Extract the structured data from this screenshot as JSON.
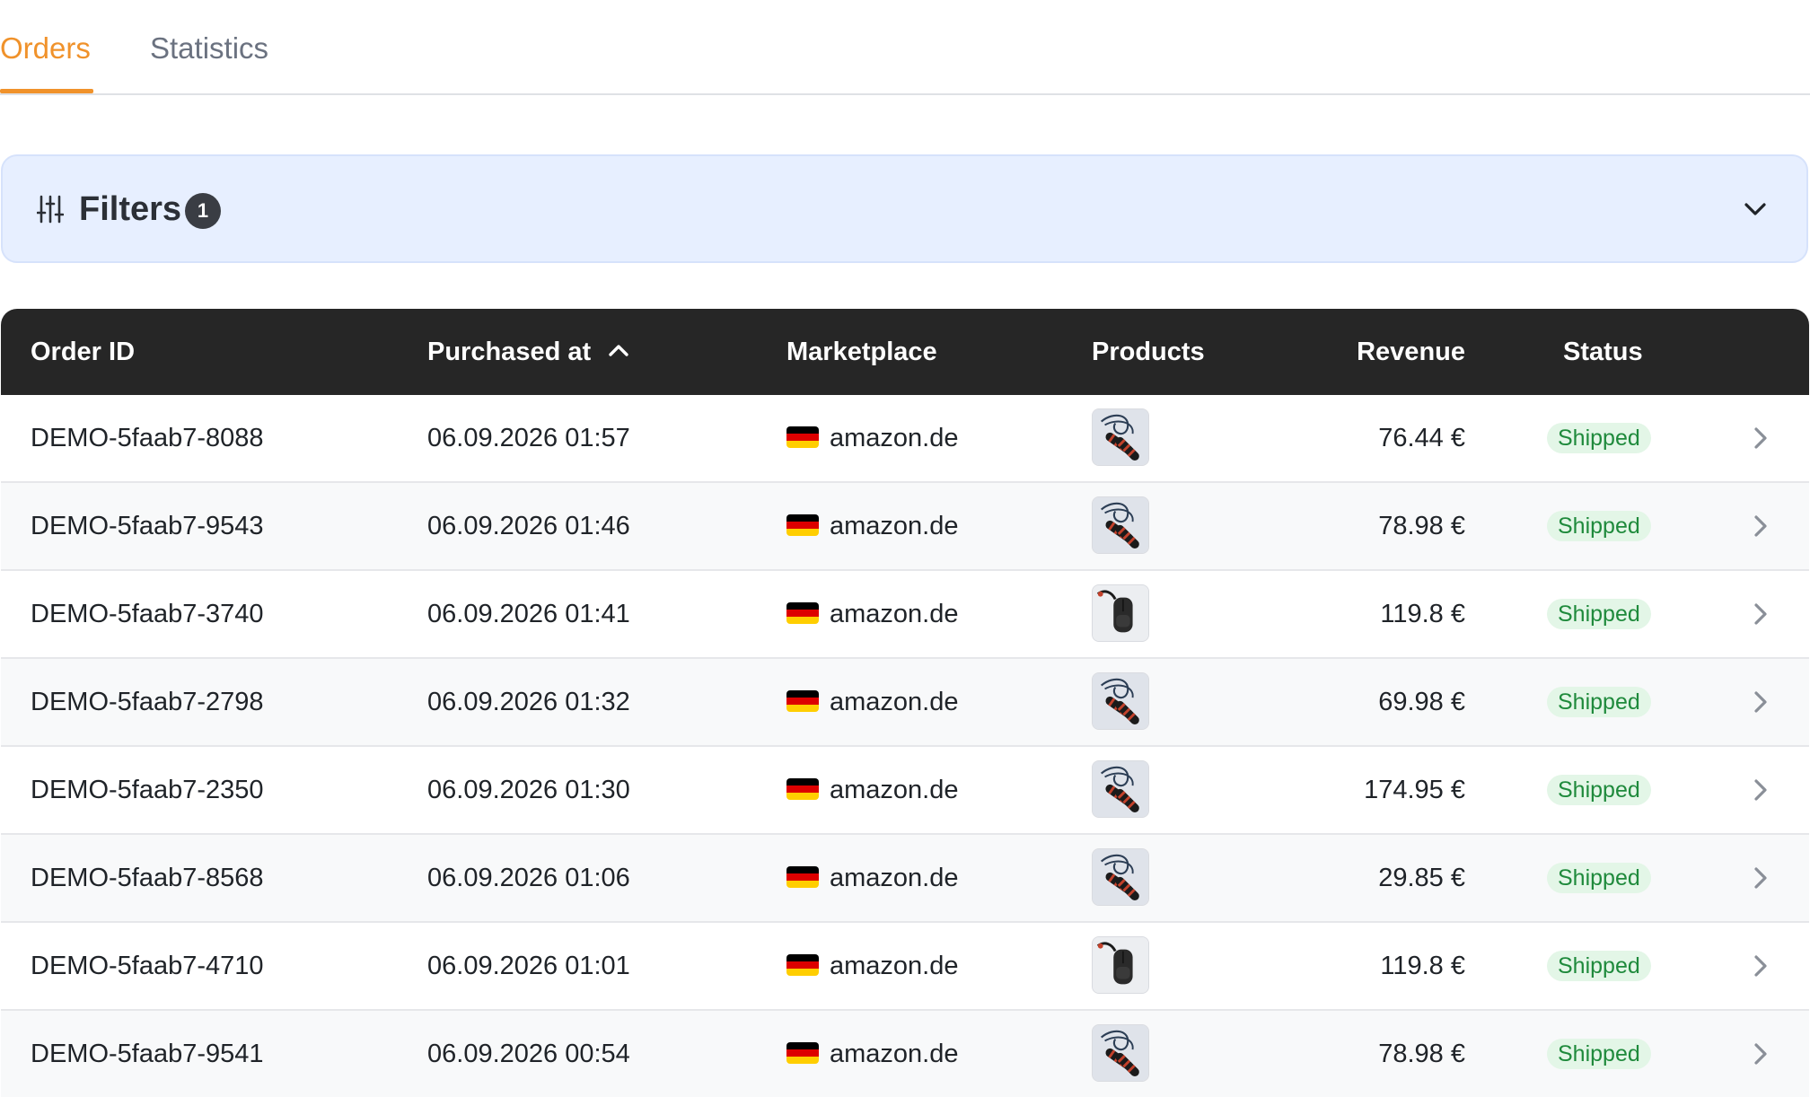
{
  "tabs": [
    {
      "label": "Orders",
      "active": true
    },
    {
      "label": "Statistics",
      "active": false
    }
  ],
  "filters": {
    "title": "Filters",
    "count": "1",
    "icon": "sliders-icon",
    "toggle_icon": "chevron-down-icon",
    "background": "#e7efff"
  },
  "table": {
    "columns": {
      "order_id": "Order ID",
      "purchased_at": "Purchased at",
      "marketplace": "Marketplace",
      "products": "Products",
      "revenue": "Revenue",
      "status": "Status"
    },
    "sort_icon": "chevron-up-icon",
    "header_background": "#262626",
    "rows": [
      {
        "order_id": "DEMO-5faab7-8088",
        "purchased_at": "06.09.2026 01:57",
        "marketplace": "amazon.de",
        "product": "jump-rope",
        "revenue": "76.44 €",
        "status": "Shipped"
      },
      {
        "order_id": "DEMO-5faab7-9543",
        "purchased_at": "06.09.2026 01:46",
        "marketplace": "amazon.de",
        "product": "jump-rope",
        "revenue": "78.98 €",
        "status": "Shipped"
      },
      {
        "order_id": "DEMO-5faab7-3740",
        "purchased_at": "06.09.2026 01:41",
        "marketplace": "amazon.de",
        "product": "backpack",
        "revenue": "119.8 €",
        "status": "Shipped"
      },
      {
        "order_id": "DEMO-5faab7-2798",
        "purchased_at": "06.09.2026 01:32",
        "marketplace": "amazon.de",
        "product": "jump-rope",
        "revenue": "69.98 €",
        "status": "Shipped"
      },
      {
        "order_id": "DEMO-5faab7-2350",
        "purchased_at": "06.09.2026 01:30",
        "marketplace": "amazon.de",
        "product": "jump-rope",
        "revenue": "174.95 €",
        "status": "Shipped"
      },
      {
        "order_id": "DEMO-5faab7-8568",
        "purchased_at": "06.09.2026 01:06",
        "marketplace": "amazon.de",
        "product": "jump-rope",
        "revenue": "29.85 €",
        "status": "Shipped"
      },
      {
        "order_id": "DEMO-5faab7-4710",
        "purchased_at": "06.09.2026 01:01",
        "marketplace": "amazon.de",
        "product": "backpack",
        "revenue": "119.8 €",
        "status": "Shipped"
      },
      {
        "order_id": "DEMO-5faab7-9541",
        "purchased_at": "06.09.2026 00:54",
        "marketplace": "amazon.de",
        "product": "jump-rope",
        "revenue": "78.98 €",
        "status": "Shipped"
      }
    ]
  },
  "colors": {
    "accent": "#f0922b",
    "status_shipped_bg": "#e3f6e7",
    "status_shipped_text": "#1f8a3c"
  }
}
